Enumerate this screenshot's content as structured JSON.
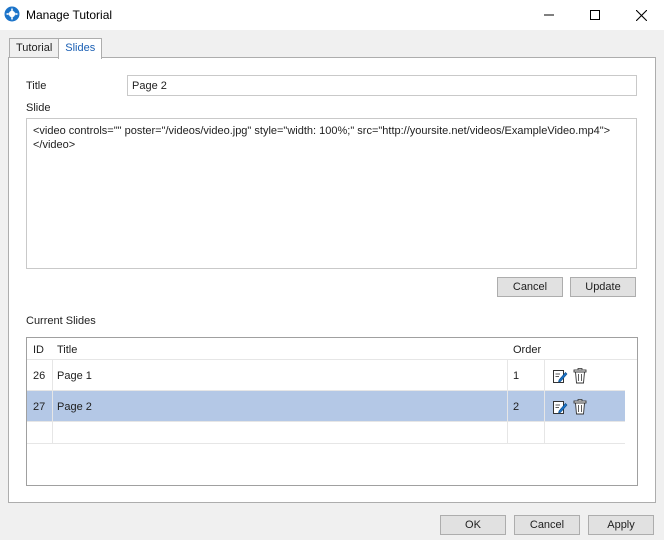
{
  "window": {
    "title": "Manage Tutorial"
  },
  "tabs": [
    {
      "label": "Tutorial"
    },
    {
      "label": "Slides"
    }
  ],
  "form": {
    "title_label": "Title",
    "title_value": "Page 2",
    "slide_label": "Slide",
    "slide_value": "<video controls=\"\" poster=\"/videos/video.jpg\" style=\"width: 100%;\" src=\"http://yoursite.net/videos/ExampleVideo.mp4\">\n</video>",
    "cancel_label": "Cancel",
    "update_label": "Update"
  },
  "slides": {
    "label": "Current Slides",
    "columns": [
      "ID",
      "Title",
      "Order"
    ],
    "rows": [
      {
        "id": "26",
        "title": "Page 1",
        "order": "1"
      },
      {
        "id": "27",
        "title": "Page 2",
        "order": "2"
      }
    ]
  },
  "footer": {
    "ok_label": "OK",
    "cancel_label": "Cancel",
    "apply_label": "Apply"
  },
  "icons": {
    "app": "app-logo-icon",
    "edit": "edit-icon",
    "delete": "trash-icon"
  },
  "colors": {
    "selected_row": "#b4c8e6",
    "active_tab_text": "#1a5fb4",
    "app_icon": "#1a73c9"
  }
}
